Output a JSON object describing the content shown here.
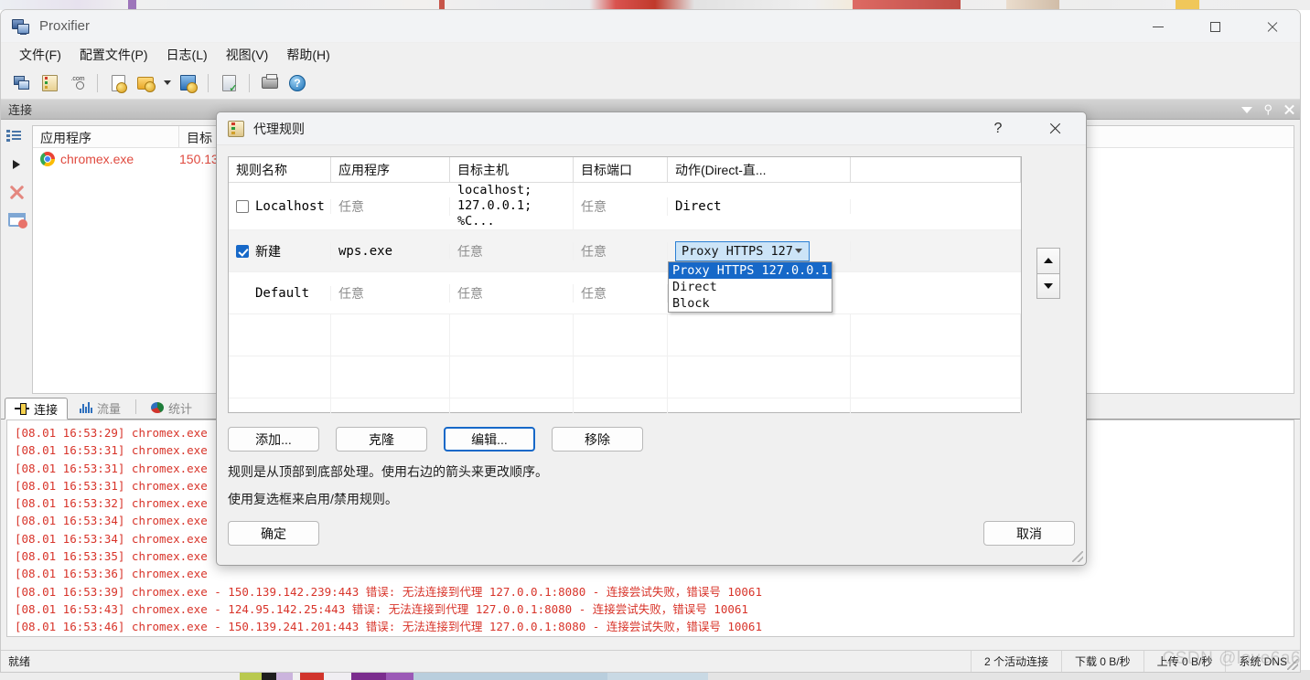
{
  "app": {
    "title": "Proxifier",
    "icon": "proxifier-monitors-icon",
    "window_controls": {
      "minimize": "—",
      "maximize": "▢",
      "close": "✕"
    }
  },
  "menubar": {
    "items": [
      {
        "label": "文件(F)",
        "name": "menu-file"
      },
      {
        "label": "配置文件(P)",
        "name": "menu-profile"
      },
      {
        "label": "日志(L)",
        "name": "menu-log"
      },
      {
        "label": "视图(V)",
        "name": "menu-view"
      },
      {
        "label": "帮助(H)",
        "name": "menu-help"
      }
    ]
  },
  "toolbar": {
    "icons": [
      "monitors-icon",
      "rules-list-icon",
      "com-search-icon",
      "new-profile-icon",
      "open-profile-icon",
      "save-profile-icon",
      "verify-clipboard-icon",
      "print-icon",
      "help-icon"
    ]
  },
  "dock": {
    "title": "连接",
    "tools": [
      "chevron-down-icon",
      "pin-icon",
      "close-icon"
    ]
  },
  "connections": {
    "sidebar_icons": [
      "list-columns-icon",
      "play-icon",
      "close-red-icon",
      "close-window-icon"
    ],
    "columns": [
      "应用程序",
      "目标"
    ],
    "rows": [
      {
        "app": "chromex.exe",
        "target": "150.13",
        "icon": "chrome-icon"
      }
    ]
  },
  "tabs": [
    {
      "label": "连接",
      "icon": "connection-icon",
      "active": true
    },
    {
      "label": "流量",
      "icon": "traffic-bars-icon",
      "active": false
    },
    {
      "label": "统计",
      "icon": "stats-pie-icon",
      "active": false
    }
  ],
  "log": {
    "lines": [
      "[08.01 16:53:29] chromex.exe",
      "[08.01 16:53:31] chromex.exe",
      "[08.01 16:53:31] chromex.exe",
      "[08.01 16:53:31] chromex.exe",
      "[08.01 16:53:32] chromex.exe",
      "[08.01 16:53:34] chromex.exe",
      "[08.01 16:53:34] chromex.exe",
      "[08.01 16:53:35] chromex.exe",
      "[08.01 16:53:36] chromex.exe",
      "[08.01 16:53:39] chromex.exe - 150.139.142.239:443 错误: 无法连接到代理 127.0.0.1:8080 - 连接尝试失败，错误号 10061",
      "[08.01 16:53:43] chromex.exe - 124.95.142.25:443 错误: 无法连接到代理 127.0.0.1:8080 - 连接尝试失败，错误号 10061",
      "[08.01 16:53:46] chromex.exe - 150.139.241.201:443 错误: 无法连接到代理 127.0.0.1:8080 - 连接尝试失败，错误号 10061"
    ]
  },
  "statusbar": {
    "ready": "就绪",
    "connections": "2 个活动连接",
    "download": "下载 0 B/秒",
    "upload": "上传 0 B/秒",
    "dns": "系统 DNS"
  },
  "dialog": {
    "title": "代理规则",
    "icon": "proxy-rules-icon",
    "help_label": "?",
    "close_label": "✕",
    "grid": {
      "columns": [
        "规则名称",
        "应用程序",
        "目标主机",
        "目标端口",
        "动作(Direct-直..."
      ],
      "rows": [
        {
          "checkbox": "unchecked",
          "name": "Localhost",
          "app": "任意",
          "host_line1": "localhost;",
          "host_line2": "127.0.0.1; %C...",
          "port": "任意",
          "action": "Direct",
          "selected": false
        },
        {
          "checkbox": "checked",
          "name": "新建",
          "app": "wps.exe",
          "host_line1": "任意",
          "host_line2": "",
          "port": "任意",
          "action": "Proxy HTTPS 127",
          "selected": true,
          "dropdown_open": true
        },
        {
          "checkbox": "none",
          "name": "Default",
          "app": "任意",
          "host_line1": "任意",
          "host_line2": "",
          "port": "任意",
          "action": "",
          "selected": false
        }
      ]
    },
    "dropdown": {
      "selected_value": "Proxy HTTPS 127",
      "options": [
        {
          "label": "Proxy HTTPS 127.0.0.1",
          "selected": true
        },
        {
          "label": "Direct",
          "selected": false
        },
        {
          "label": "Block",
          "selected": false
        }
      ]
    },
    "order_arrows": {
      "up": "move-up",
      "down": "move-down"
    },
    "buttons": {
      "add": "添加...",
      "clone": "克隆",
      "edit": "编辑...",
      "remove": "移除",
      "ok": "确定",
      "cancel": "取消"
    },
    "hints": {
      "line1": "规则是从顶部到底部处理。使用右边的箭头来更改顺序。",
      "line2": "使用复选框来启用/禁用规则。"
    }
  },
  "watermark": "CSDN @love6a6"
}
